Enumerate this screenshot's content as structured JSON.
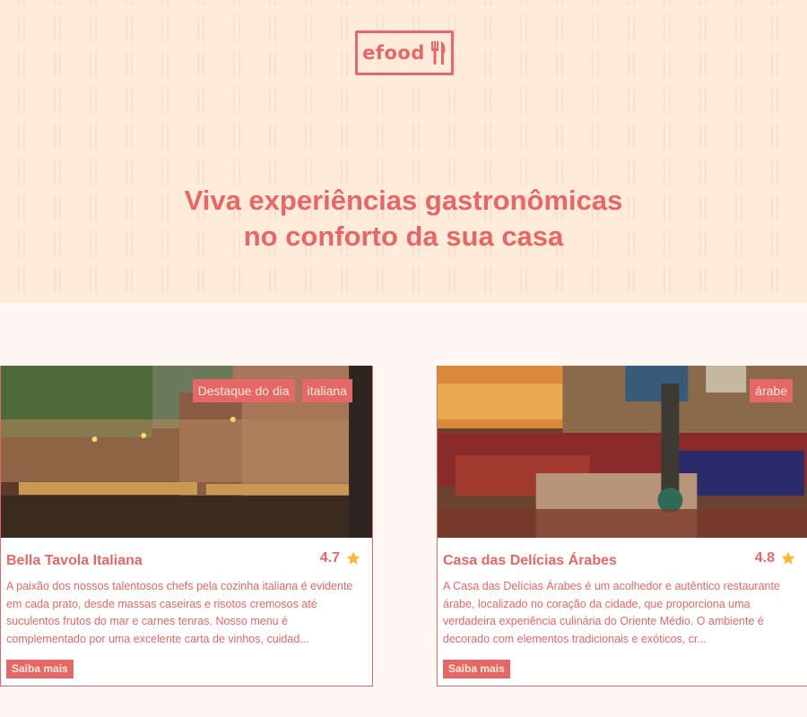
{
  "header": {
    "logo_text": "efood",
    "logo_icon": "fork-knife-icon",
    "title_line1": "Viva experiências gastronômicas",
    "title_line2": "no conforto da sua casa"
  },
  "restaurants": [
    {
      "title": "Bella Tavola Italiana",
      "rating": "4.7",
      "tags": [
        "Destaque do dia",
        "italiana"
      ],
      "description": "A paixão dos nossos talentosos chefs pela cozinha italiana é evidente em cada prato, desde massas caseiras e risotos cremosos até suculentos frutos do mar e carnes tenras. Nosso menu é complementado por uma excelente carta de vinhos, cuidad...",
      "button": "Saiba mais"
    },
    {
      "title": "Casa das Delícias Árabes",
      "rating": "4.8",
      "tags": [
        "árabe"
      ],
      "description": "A Casa das Delícias Árabes é um acolhedor e autêntico restaurante árabe, localizado no coração da cidade, que proporciona uma verdadeira experiência culinária do Oriente Médio. O ambiente é decorado com elementos tradicionais e exóticos, cr...",
      "button": "Saiba mais"
    }
  ],
  "colors": {
    "primary": "#e66767",
    "hero_bg": "#ffebd9",
    "page_bg": "#fff8f2"
  }
}
